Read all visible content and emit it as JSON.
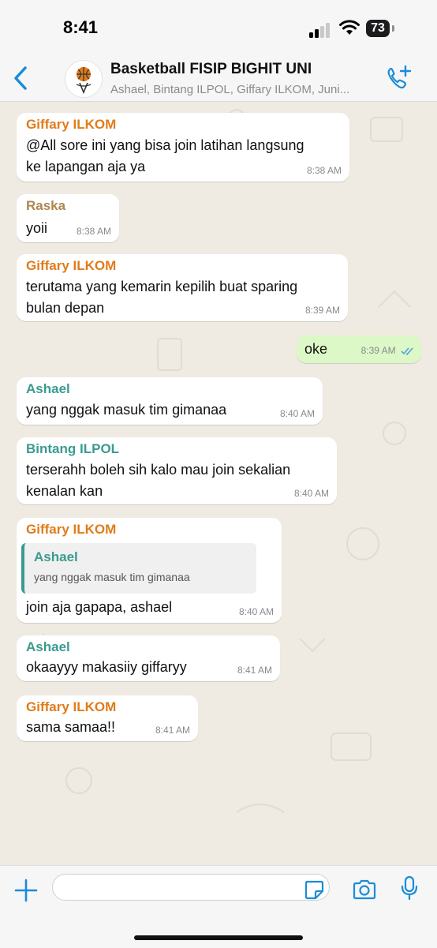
{
  "status_bar": {
    "time": "8:41",
    "battery": "73"
  },
  "header": {
    "title": "Basketball FISIP BIGHIT UNI",
    "subtitle": "Ashael, Bintang ILPOL, Giffary ILKOM, Juni..."
  },
  "colors": {
    "accent": "#1a8cd8",
    "sender_orange": "#e07b1a",
    "sender_brown": "#b08650",
    "sender_teal": "#3a9b8f",
    "outgoing_bubble": "#dcf8c6"
  },
  "messages": [
    {
      "sender": "Giffary ILKOM",
      "lines": [
        "@All sore ini yang bisa join latihan langsung",
        "ke lapangan aja ya"
      ],
      "time": "8:38 AM"
    },
    {
      "sender": "Raska",
      "lines": [
        "yoii"
      ],
      "time": "8:38 AM"
    },
    {
      "sender": "Giffary ILKOM",
      "lines": [
        "terutama yang kemarin kepilih buat sparing",
        "bulan depan"
      ],
      "time": "8:39 AM"
    },
    {
      "sender": "",
      "lines": [
        "oke"
      ],
      "time": "8:39 AM",
      "outgoing": true
    },
    {
      "sender": "Ashael",
      "lines": [
        "yang nggak masuk tim gimanaa"
      ],
      "time": "8:40 AM"
    },
    {
      "sender": "Bintang ILPOL",
      "lines": [
        "terserahh boleh sih kalo mau join sekalian",
        "kenalan kan"
      ],
      "time": "8:40 AM"
    },
    {
      "sender": "Giffary ILKOM",
      "quote": {
        "name": "Ashael",
        "text": "yang nggak masuk tim gimanaa"
      },
      "lines": [
        "join aja gapapa, ashael"
      ],
      "time": "8:40 AM"
    },
    {
      "sender": "Ashael",
      "lines": [
        "okaayyy makasiiy giffaryy"
      ],
      "time": "8:41 AM"
    },
    {
      "sender": "Giffary ILKOM",
      "lines": [
        "sama samaa!!"
      ],
      "time": "8:41 AM"
    }
  ],
  "input": {
    "placeholder": ""
  },
  "icons": [
    "back-chevron-icon",
    "group-avatar-icon",
    "add-call-icon",
    "plus-icon",
    "sticker-icon",
    "camera-icon",
    "microphone-icon"
  ]
}
